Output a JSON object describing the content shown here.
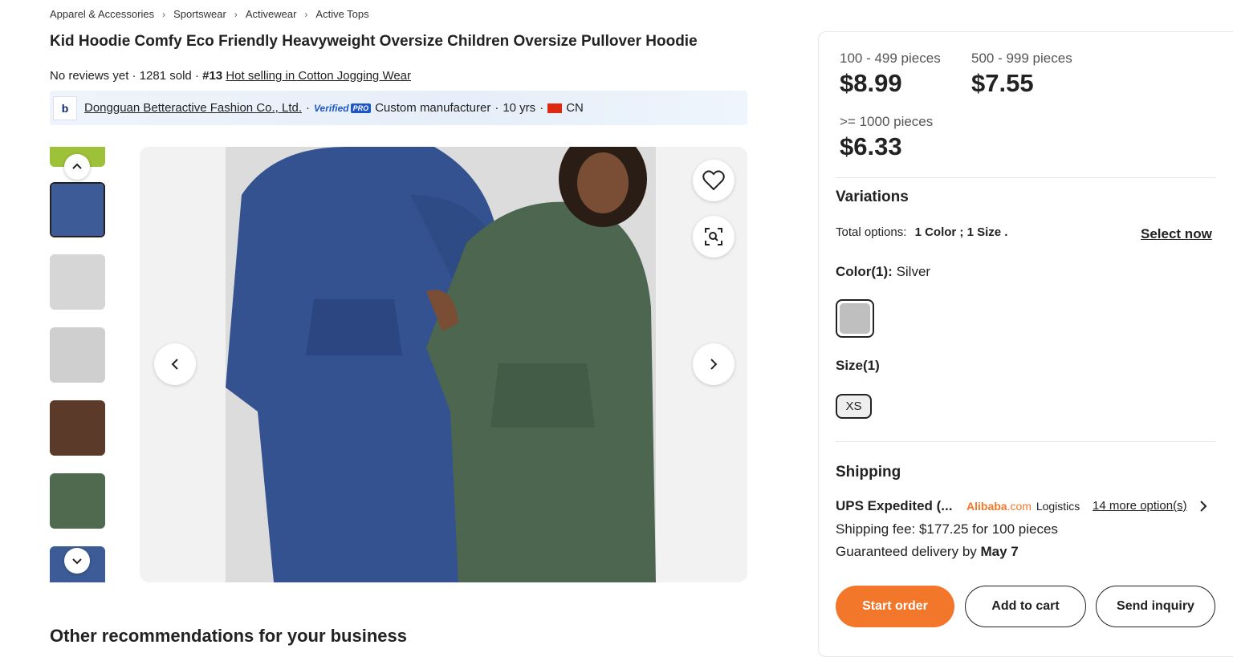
{
  "breadcrumb": [
    "Apparel & Accessories",
    "Sportswear",
    "Activewear",
    "Active Tops"
  ],
  "product": {
    "title": "Kid Hoodie Comfy Eco Friendly Heavyweight Oversize Children Oversize Pullover Hoodie",
    "reviews": "No reviews yet",
    "sold": "1281 sold",
    "rank": "#13",
    "rank_link": "Hot selling in Cotton Jogging Wear"
  },
  "supplier": {
    "logo_text": "b",
    "name": "Dongguan Betteractive Fashion Co., Ltd.",
    "verified": "Verified",
    "pro": "PRO",
    "type": "Custom manufacturer",
    "years": "10 yrs",
    "country": "CN"
  },
  "gallery": {
    "thumb_colors": [
      "#9ec13a",
      "#3d5c97",
      "#d6d6d6",
      "#cfcfcf",
      "#5b3a2a",
      "#4f6a4f",
      "#3d5c97"
    ],
    "selected_index": 1
  },
  "pricing": [
    {
      "qty": "100 - 499 pieces",
      "price": "$8.99"
    },
    {
      "qty": "500 - 999 pieces",
      "price": "$7.55"
    },
    {
      "qty": ">= 1000 pieces",
      "price": "$6.33"
    }
  ],
  "variations": {
    "heading": "Variations",
    "total_label": "Total options:",
    "total_value": "1 Color ; 1 Size .",
    "select_now": "Select now",
    "color_label": "Color(1):",
    "color_value": "Silver",
    "swatch_color": "#bfbfbf",
    "size_label": "Size(1)",
    "size_value": "XS"
  },
  "shipping": {
    "heading": "Shipping",
    "method": "UPS Expedited (...",
    "logistics_brand": "Alibaba",
    "logistics_com": ".com",
    "logistics_word": "Logistics",
    "more_options": "14 more option(s)",
    "fee": "Shipping fee: $177.25 for 100 pieces",
    "delivery_prefix": "Guaranteed delivery by",
    "delivery_date": "May 7"
  },
  "actions": {
    "start_order": "Start order",
    "add_to_cart": "Add to cart",
    "send_inquiry": "Send inquiry"
  },
  "footer_heading": "Other recommendations for your business",
  "colors": {
    "accent": "#f2772b",
    "alibaba": "#f2772b",
    "verified": "#1c56c7"
  }
}
